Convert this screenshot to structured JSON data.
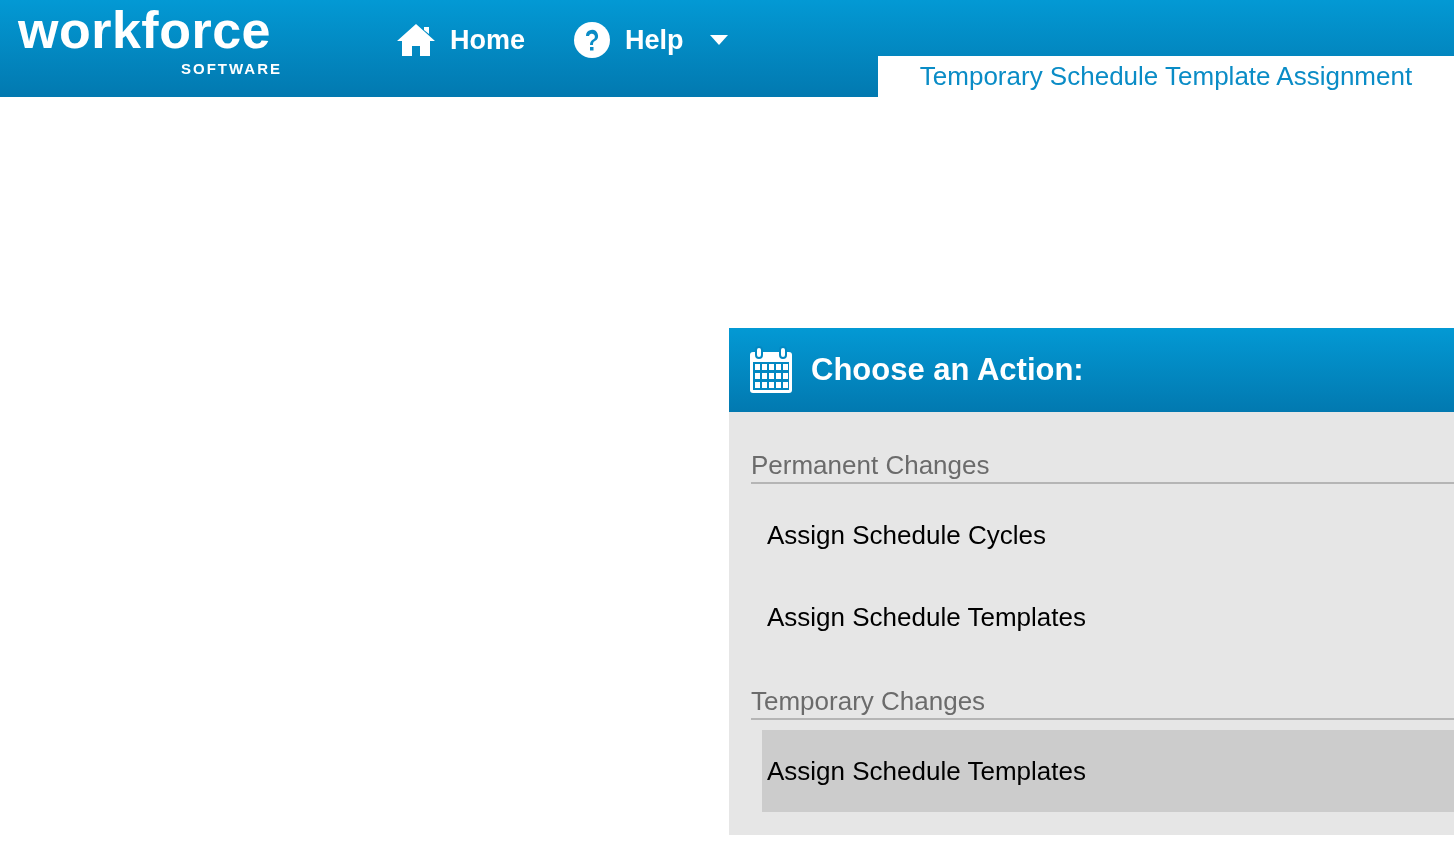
{
  "logo": {
    "name": "workforce",
    "tagline": "SOFTWARE"
  },
  "nav": [
    {
      "kind": "home",
      "label": "Home"
    },
    {
      "kind": "help",
      "label": "Help",
      "dropdown": true
    }
  ],
  "page_tab": {
    "label": "Temporary Schedule Template Assignment"
  },
  "panel": {
    "title": "Choose an Action:",
    "sections": [
      {
        "heading": "Permanent Changes",
        "items": [
          {
            "label": "Assign Schedule Cycles",
            "selected": false
          },
          {
            "label": "Assign Schedule Templates",
            "selected": false
          }
        ]
      },
      {
        "heading": "Temporary Changes",
        "items": [
          {
            "label": "Assign Schedule Templates",
            "selected": true
          }
        ]
      }
    ]
  }
}
